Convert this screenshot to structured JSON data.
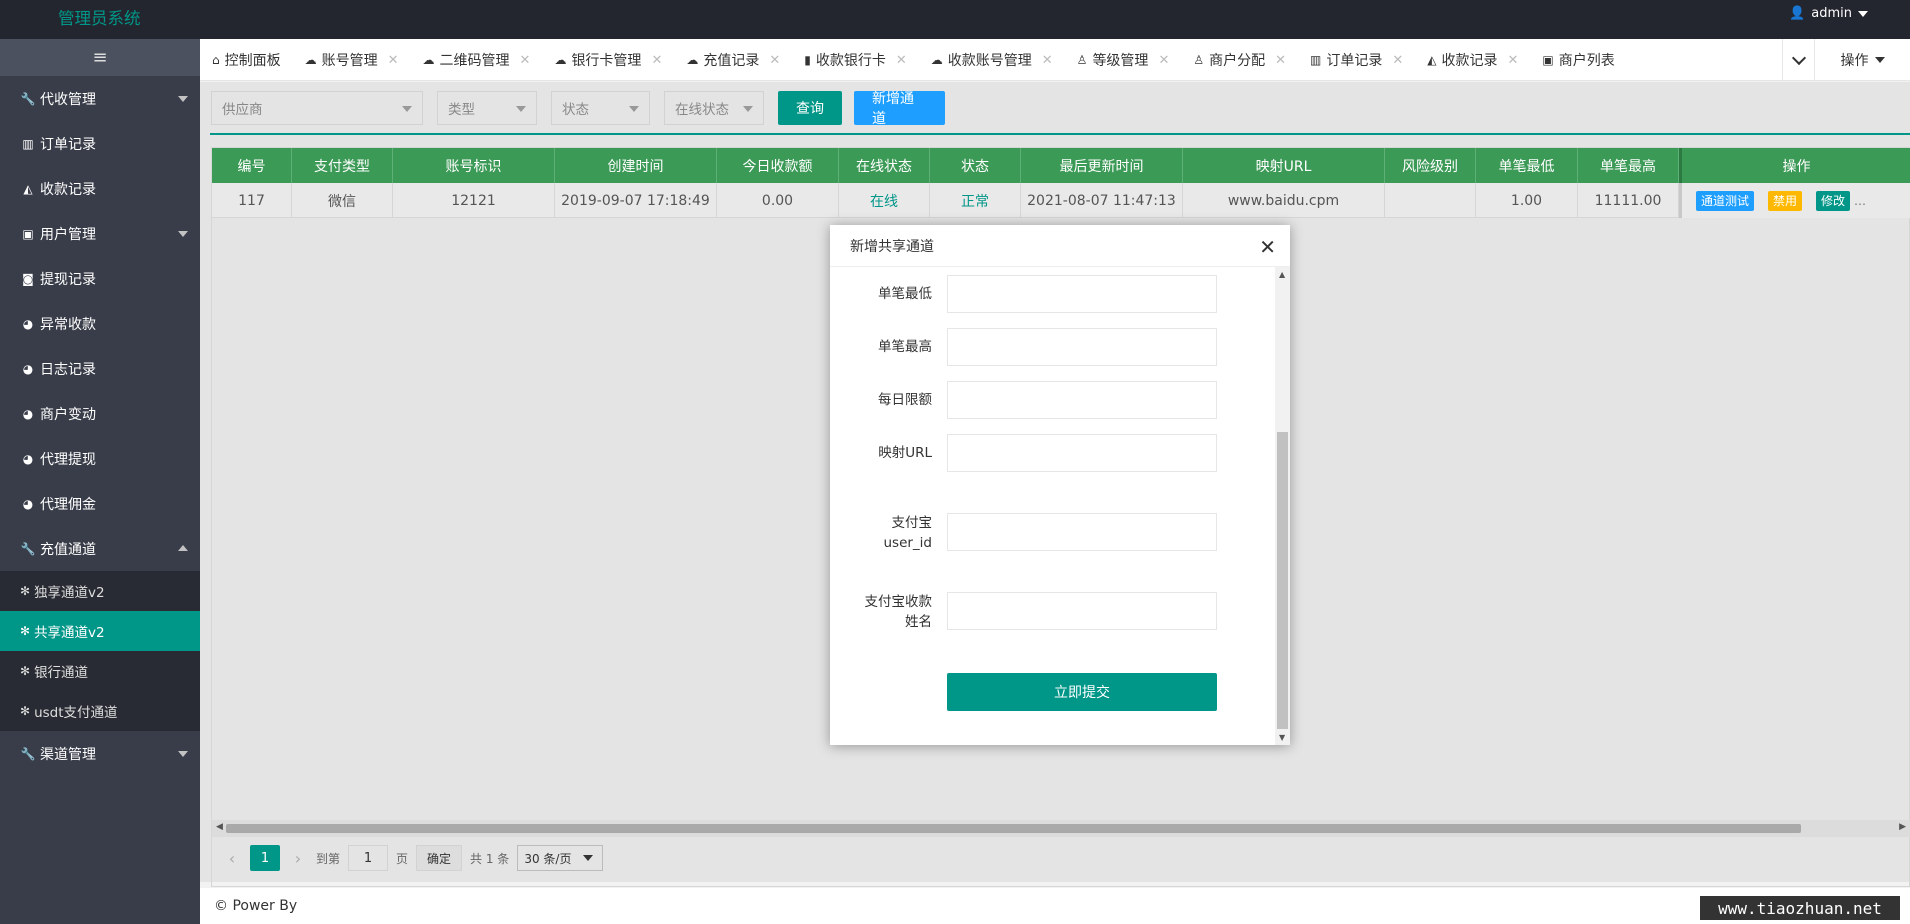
{
  "header": {
    "brand": "管理员系统",
    "user": "admin"
  },
  "sidebar": {
    "toggle_icon": "≡",
    "items": [
      {
        "label": "代收管理",
        "icon": "wrench-icon",
        "glyph": "🔧",
        "caret": "down"
      },
      {
        "label": "订单记录",
        "icon": "bar-chart-icon",
        "glyph": "▥"
      },
      {
        "label": "收款记录",
        "icon": "area-chart-icon",
        "glyph": "◭"
      },
      {
        "label": "用户管理",
        "icon": "user-card-icon",
        "glyph": "▣",
        "caret": "down"
      },
      {
        "label": "提现记录",
        "icon": "money-icon",
        "glyph": "◙"
      },
      {
        "label": "异常收款",
        "icon": "pie-chart-icon",
        "glyph": "◕"
      },
      {
        "label": "日志记录",
        "icon": "pie-chart-icon",
        "glyph": "◕"
      },
      {
        "label": "商户变动",
        "icon": "pie-chart-icon",
        "glyph": "◕"
      },
      {
        "label": "代理提现",
        "icon": "pie-chart-icon",
        "glyph": "◕"
      },
      {
        "label": "代理佣金",
        "icon": "pie-chart-icon",
        "glyph": "◕"
      },
      {
        "label": "充值通道",
        "icon": "wrench-icon",
        "glyph": "🔧",
        "caret": "up"
      }
    ],
    "subitems": [
      {
        "label": "独享通道v2",
        "icon": "wechat-icon",
        "glyph": "✻"
      },
      {
        "label": "共享通道v2",
        "icon": "wechat-icon",
        "glyph": "✻",
        "active": true
      },
      {
        "label": "银行通道",
        "icon": "wechat-icon",
        "glyph": "✻"
      },
      {
        "label": "usdt支付通道",
        "icon": "wechat-icon",
        "glyph": "✻"
      }
    ],
    "last_item": {
      "label": "渠道管理",
      "icon": "wrench-icon",
      "glyph": "🔧",
      "caret": "down"
    }
  },
  "tabs": [
    {
      "label": "控制面板",
      "icon": "home-icon",
      "glyph": "⌂",
      "closable": false
    },
    {
      "label": "账号管理",
      "icon": "cloud-upload-icon",
      "glyph": "☁",
      "closable": true
    },
    {
      "label": "二维码管理",
      "icon": "cloud-upload-icon",
      "glyph": "☁",
      "closable": true
    },
    {
      "label": "银行卡管理",
      "icon": "cloud-upload-icon",
      "glyph": "☁",
      "closable": true
    },
    {
      "label": "充值记录",
      "icon": "cloud-upload-icon",
      "glyph": "☁",
      "closable": true
    },
    {
      "label": "收款银行卡",
      "icon": "book-icon",
      "glyph": "▮",
      "closable": true
    },
    {
      "label": "收款账号管理",
      "icon": "cloud-upload-icon",
      "glyph": "☁",
      "closable": true
    },
    {
      "label": "等级管理",
      "icon": "user-icon",
      "glyph": "♙",
      "closable": true
    },
    {
      "label": "商户分配",
      "icon": "user-icon",
      "glyph": "♙",
      "closable": true
    },
    {
      "label": "订单记录",
      "icon": "bar-chart-icon",
      "glyph": "▥",
      "closable": true
    },
    {
      "label": "收款记录",
      "icon": "area-chart-icon",
      "glyph": "◭",
      "closable": true
    },
    {
      "label": "商户列表",
      "icon": "contact-icon",
      "glyph": "▣",
      "closable": false
    }
  ],
  "tab_ops_label": "操作",
  "filters": {
    "supplier": "供应商",
    "type": "类型",
    "status": "状态",
    "online": "在线状态",
    "query_button": "查询",
    "add_button": "新增通道"
  },
  "table": {
    "columns": [
      "编号",
      "支付类型",
      "账号标识",
      "创建时间",
      "今日收款额",
      "在线状态",
      "状态",
      "最后更新时间",
      "映射URL",
      "风险级别",
      "单笔最低",
      "单笔最高"
    ],
    "ops_header": "操作",
    "row": [
      "117",
      "微信",
      "12121",
      "2019-09-07 17:18:49",
      "0.00",
      "在线",
      "正常",
      "2021-08-07 11:47:13",
      "www.baidu.cpm",
      "",
      "1.00",
      "11111.00"
    ],
    "ops": {
      "test": "通道测试",
      "disable": "禁用",
      "edit": "修改",
      "more": "…"
    }
  },
  "pager": {
    "current": "1",
    "goto_label": "到第",
    "page_input": "1",
    "page_label": "页",
    "confirm": "确定",
    "total": "共 1 条",
    "size": "30 条/页"
  },
  "footer": {
    "text": "© Power By"
  },
  "watermark": "www.tiaozhuan.net",
  "modal": {
    "title": "新增共享通道",
    "fields": [
      {
        "label": "单笔最低",
        "value": ""
      },
      {
        "label": "单笔最高",
        "value": ""
      },
      {
        "label": "每日限额",
        "value": ""
      },
      {
        "label": "映射URL",
        "value": ""
      },
      {
        "label_line1": "支付宝",
        "label_line2": "user_id",
        "value": ""
      },
      {
        "label_line1": "支付宝收款",
        "label_line2": "姓名",
        "value": ""
      }
    ],
    "submit": "立即提交"
  },
  "colors": {
    "brand": "#009688",
    "sidebar": "#393d49",
    "table_header": "#3c9a57",
    "blue": "#1e9fff",
    "orange": "#ffb800"
  }
}
